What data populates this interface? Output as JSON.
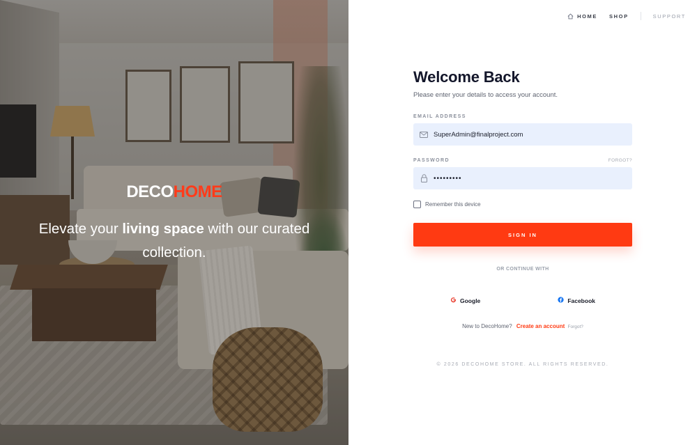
{
  "hero": {
    "brand_part1": "DECO",
    "brand_part2": "HOME",
    "tagline_pre": "Elevate your ",
    "tagline_bold": "living space",
    "tagline_post": " with our curated collection."
  },
  "nav": {
    "home": "HOME",
    "shop": "SHOP",
    "support": "SUPPORT"
  },
  "form": {
    "title": "Welcome Back",
    "subtitle": "Please enter your details to access your account.",
    "email_label": "EMAIL ADDRESS",
    "email_value": "SuperAdmin@finalproject.com",
    "password_label": "PASSWORD",
    "forgot_label": "FORGOT?",
    "password_value": "superpass",
    "remember_label": "Remember this device",
    "signin_label": "SIGN IN",
    "or_label": "OR CONTINUE WITH",
    "google_label": "Google",
    "facebook_label": "Facebook",
    "signup_prompt": "New to DecoHome?",
    "create_label": "Create an account",
    "forgot2_label": "Forgot?"
  },
  "footer": {
    "copyright": "© 2026 DECOHOME STORE. ALL RIGHTS RESERVED."
  },
  "colors": {
    "accent": "#ff3a12",
    "input_bg": "#e9f0fd",
    "google_red": "#ea4335",
    "facebook_blue": "#1877f2"
  },
  "icons": {
    "home": "home-icon",
    "email": "mail-icon",
    "password": "lock-icon",
    "google": "google-icon",
    "facebook": "facebook-icon"
  }
}
